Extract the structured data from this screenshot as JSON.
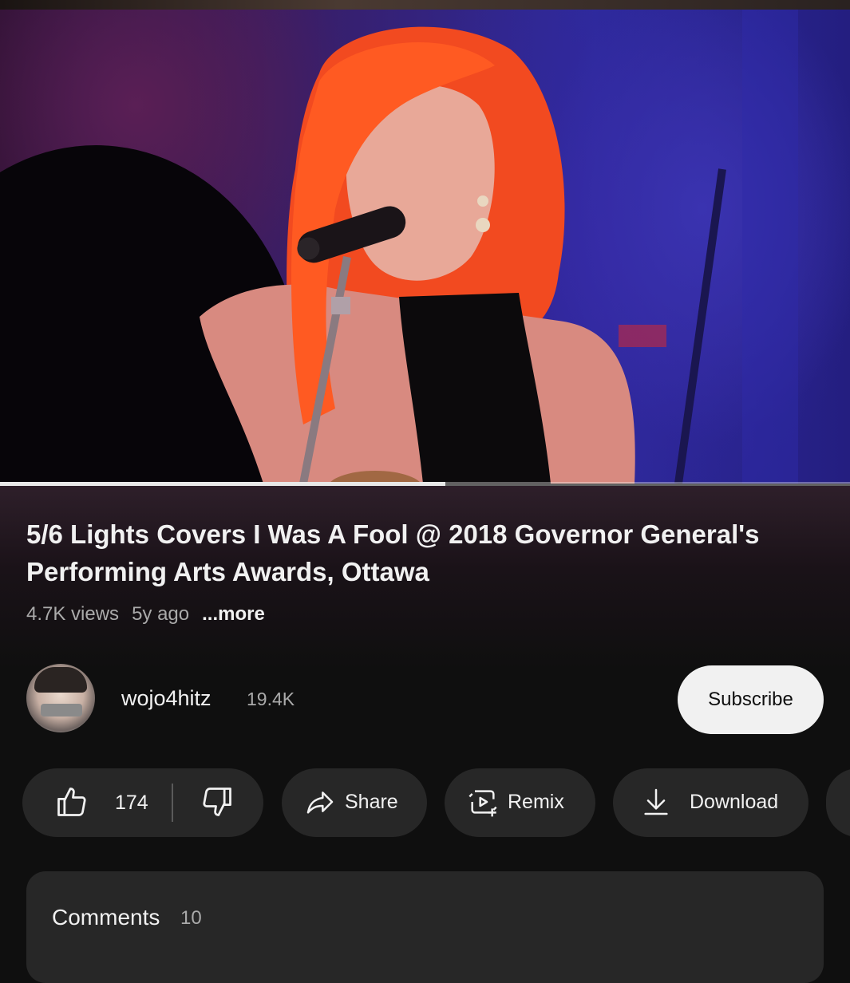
{
  "video": {
    "title": "5/6 Lights Covers I Was A Fool @ 2018 Governor General's Performing Arts Awards, Ottawa",
    "views": "4.7K views",
    "age": "5y ago",
    "more_label": "...more",
    "progress": 0.524
  },
  "channel": {
    "name": "wojo4hitz",
    "subscribers": "19.4K",
    "subscribe_label": "Subscribe"
  },
  "actions": {
    "like_count": "174",
    "share_label": "Share",
    "remix_label": "Remix",
    "download_label": "Download"
  },
  "comments": {
    "title": "Comments",
    "count": "10"
  },
  "icons": [
    "thumbs-up-icon",
    "thumbs-down-icon",
    "share-arrow-icon",
    "remix-icon",
    "download-icon"
  ],
  "colors": {
    "background": "#0f0f0f",
    "pill": "#272727",
    "subscribe_bg": "#f1f1f1",
    "secondary_text": "#aaaaaa"
  }
}
